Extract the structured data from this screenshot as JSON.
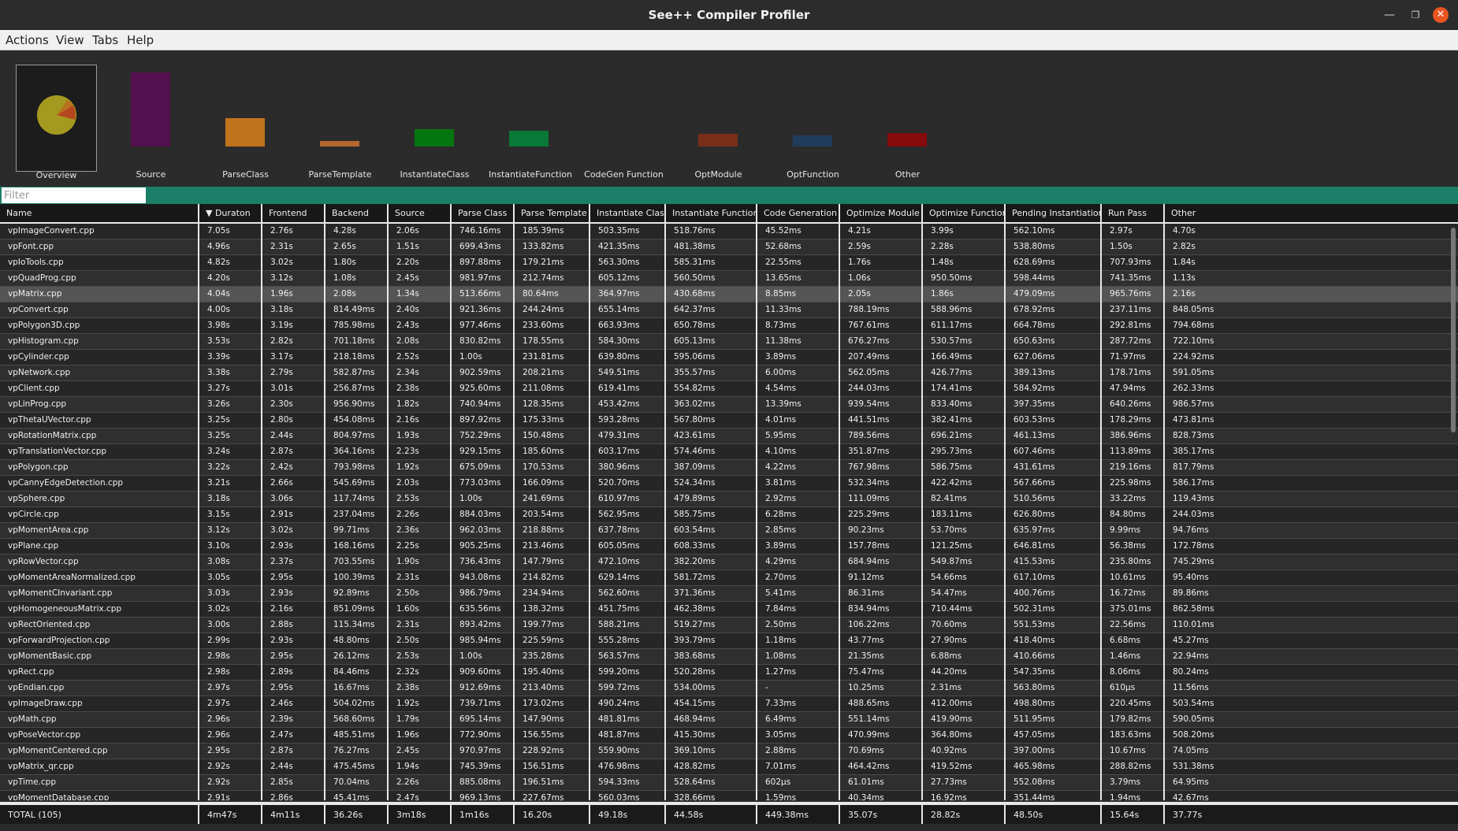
{
  "window": {
    "title": "See++ Compiler Profiler"
  },
  "menu": [
    "Actions",
    "View",
    "Tabs",
    "Help"
  ],
  "categories": [
    {
      "label": "Overview",
      "icon": "pie-chart-icon"
    },
    {
      "label": "Source",
      "icon": "bar-icon",
      "color": "#55104f"
    },
    {
      "label": "ParseClass",
      "icon": "bar-icon",
      "color": "#c0731d"
    },
    {
      "label": "ParseTemplate",
      "icon": "bar-icon",
      "color": "#b5672e"
    },
    {
      "label": "InstantiateClass",
      "icon": "bar-icon",
      "color": "#05750f"
    },
    {
      "label": "InstantiateFunction",
      "icon": "bar-icon",
      "color": "#087936"
    },
    {
      "label": "CodeGen Function",
      "icon": "bar-icon",
      "color": "#2b2b2b"
    },
    {
      "label": "OptModule",
      "icon": "bar-icon",
      "color": "#7a2e17"
    },
    {
      "label": "OptFunction",
      "icon": "bar-icon",
      "color": "#213c5a"
    },
    {
      "label": "Other",
      "icon": "bar-icon",
      "color": "#860b0b"
    }
  ],
  "filter": {
    "placeholder": "Filter"
  },
  "table": {
    "columns": [
      "Name",
      "▼ Duraton",
      "Frontend",
      "Backend",
      "Source",
      "Parse Class",
      "Parse Template",
      "Instantiate Class",
      "Instantiate Function",
      "Code Generation",
      "Optimize Module",
      "Optimize Function",
      "Pending Instantiations",
      "Run Pass",
      "Other"
    ],
    "highlight_row": 4,
    "rows": [
      [
        "vpImageConvert.cpp",
        "7.05s",
        "2.76s",
        "4.28s",
        "2.06s",
        "746.16ms",
        "185.39ms",
        "503.35ms",
        "518.76ms",
        "45.52ms",
        "4.21s",
        "3.99s",
        "562.10ms",
        "2.97s",
        "4.70s"
      ],
      [
        "vpFont.cpp",
        "4.96s",
        "2.31s",
        "2.65s",
        "1.51s",
        "699.43ms",
        "133.82ms",
        "421.35ms",
        "481.38ms",
        "52.68ms",
        "2.59s",
        "2.28s",
        "538.80ms",
        "1.50s",
        "2.82s"
      ],
      [
        "vpIoTools.cpp",
        "4.82s",
        "3.02s",
        "1.80s",
        "2.20s",
        "897.88ms",
        "179.21ms",
        "563.30ms",
        "585.31ms",
        "22.55ms",
        "1.76s",
        "1.48s",
        "628.69ms",
        "707.93ms",
        "1.84s"
      ],
      [
        "vpQuadProg.cpp",
        "4.20s",
        "3.12s",
        "1.08s",
        "2.45s",
        "981.97ms",
        "212.74ms",
        "605.12ms",
        "560.50ms",
        "13.65ms",
        "1.06s",
        "950.50ms",
        "598.44ms",
        "741.35ms",
        "1.13s"
      ],
      [
        "vpMatrix.cpp",
        "4.04s",
        "1.96s",
        "2.08s",
        "1.34s",
        "513.66ms",
        "80.64ms",
        "364.97ms",
        "430.68ms",
        "8.85ms",
        "2.05s",
        "1.86s",
        "479.09ms",
        "965.76ms",
        "2.16s"
      ],
      [
        "vpConvert.cpp",
        "4.00s",
        "3.18s",
        "814.49ms",
        "2.40s",
        "921.36ms",
        "244.24ms",
        "655.14ms",
        "642.37ms",
        "11.33ms",
        "788.19ms",
        "588.96ms",
        "678.92ms",
        "237.11ms",
        "848.05ms"
      ],
      [
        "vpPolygon3D.cpp",
        "3.98s",
        "3.19s",
        "785.98ms",
        "2.43s",
        "977.46ms",
        "233.60ms",
        "663.93ms",
        "650.78ms",
        "8.73ms",
        "767.61ms",
        "611.17ms",
        "664.78ms",
        "292.81ms",
        "794.68ms"
      ],
      [
        "vpHistogram.cpp",
        "3.53s",
        "2.82s",
        "701.18ms",
        "2.08s",
        "830.82ms",
        "178.55ms",
        "584.30ms",
        "605.13ms",
        "11.38ms",
        "676.27ms",
        "530.57ms",
        "650.63ms",
        "287.72ms",
        "722.10ms"
      ],
      [
        "vpCylinder.cpp",
        "3.39s",
        "3.17s",
        "218.18ms",
        "2.52s",
        "1.00s",
        "231.81ms",
        "639.80ms",
        "595.06ms",
        "3.89ms",
        "207.49ms",
        "166.49ms",
        "627.06ms",
        "71.97ms",
        "224.92ms"
      ],
      [
        "vpNetwork.cpp",
        "3.38s",
        "2.79s",
        "582.87ms",
        "2.34s",
        "902.59ms",
        "208.21ms",
        "549.51ms",
        "355.57ms",
        "6.00ms",
        "562.05ms",
        "426.77ms",
        "389.13ms",
        "178.71ms",
        "591.05ms"
      ],
      [
        "vpClient.cpp",
        "3.27s",
        "3.01s",
        "256.87ms",
        "2.38s",
        "925.60ms",
        "211.08ms",
        "619.41ms",
        "554.82ms",
        "4.54ms",
        "244.03ms",
        "174.41ms",
        "584.92ms",
        "47.94ms",
        "262.33ms"
      ],
      [
        "vpLinProg.cpp",
        "3.26s",
        "2.30s",
        "956.90ms",
        "1.82s",
        "740.94ms",
        "128.35ms",
        "453.42ms",
        "363.02ms",
        "13.39ms",
        "939.54ms",
        "833.40ms",
        "397.35ms",
        "640.26ms",
        "986.57ms"
      ],
      [
        "vpThetaUVector.cpp",
        "3.25s",
        "2.80s",
        "454.08ms",
        "2.16s",
        "897.92ms",
        "175.33ms",
        "593.28ms",
        "567.80ms",
        "4.01ms",
        "441.51ms",
        "382.41ms",
        "603.53ms",
        "178.29ms",
        "473.81ms"
      ],
      [
        "vpRotationMatrix.cpp",
        "3.25s",
        "2.44s",
        "804.97ms",
        "1.93s",
        "752.29ms",
        "150.48ms",
        "479.31ms",
        "423.61ms",
        "5.95ms",
        "789.56ms",
        "696.21ms",
        "461.13ms",
        "386.96ms",
        "828.73ms"
      ],
      [
        "vpTranslationVector.cpp",
        "3.24s",
        "2.87s",
        "364.16ms",
        "2.23s",
        "929.15ms",
        "185.60ms",
        "603.17ms",
        "574.46ms",
        "4.10ms",
        "351.87ms",
        "295.73ms",
        "607.46ms",
        "113.89ms",
        "385.17ms"
      ],
      [
        "vpPolygon.cpp",
        "3.22s",
        "2.42s",
        "793.98ms",
        "1.92s",
        "675.09ms",
        "170.53ms",
        "380.96ms",
        "387.09ms",
        "4.22ms",
        "767.98ms",
        "586.75ms",
        "431.61ms",
        "219.16ms",
        "817.79ms"
      ],
      [
        "vpCannyEdgeDetection.cpp",
        "3.21s",
        "2.66s",
        "545.69ms",
        "2.03s",
        "773.03ms",
        "166.09ms",
        "520.70ms",
        "524.34ms",
        "3.81ms",
        "532.34ms",
        "422.42ms",
        "567.66ms",
        "225.98ms",
        "586.17ms"
      ],
      [
        "vpSphere.cpp",
        "3.18s",
        "3.06s",
        "117.74ms",
        "2.53s",
        "1.00s",
        "241.69ms",
        "610.97ms",
        "479.89ms",
        "2.92ms",
        "111.09ms",
        "82.41ms",
        "510.56ms",
        "33.22ms",
        "119.43ms"
      ],
      [
        "vpCircle.cpp",
        "3.15s",
        "2.91s",
        "237.04ms",
        "2.26s",
        "884.03ms",
        "203.54ms",
        "562.95ms",
        "585.75ms",
        "6.28ms",
        "225.29ms",
        "183.11ms",
        "626.80ms",
        "84.80ms",
        "244.03ms"
      ],
      [
        "vpMomentArea.cpp",
        "3.12s",
        "3.02s",
        "99.71ms",
        "2.36s",
        "962.03ms",
        "218.88ms",
        "637.78ms",
        "603.54ms",
        "2.85ms",
        "90.23ms",
        "53.70ms",
        "635.97ms",
        "9.99ms",
        "94.76ms"
      ],
      [
        "vpPlane.cpp",
        "3.10s",
        "2.93s",
        "168.16ms",
        "2.25s",
        "905.25ms",
        "213.46ms",
        "605.05ms",
        "608.33ms",
        "3.89ms",
        "157.78ms",
        "121.25ms",
        "646.81ms",
        "56.38ms",
        "172.78ms"
      ],
      [
        "vpRowVector.cpp",
        "3.08s",
        "2.37s",
        "703.55ms",
        "1.90s",
        "736.43ms",
        "147.79ms",
        "472.10ms",
        "382.20ms",
        "4.29ms",
        "684.94ms",
        "549.87ms",
        "415.53ms",
        "235.80ms",
        "745.29ms"
      ],
      [
        "vpMomentAreaNormalized.cpp",
        "3.05s",
        "2.95s",
        "100.39ms",
        "2.31s",
        "943.08ms",
        "214.82ms",
        "629.14ms",
        "581.72ms",
        "2.70ms",
        "91.12ms",
        "54.66ms",
        "617.10ms",
        "10.61ms",
        "95.40ms"
      ],
      [
        "vpMomentCInvariant.cpp",
        "3.03s",
        "2.93s",
        "92.89ms",
        "2.50s",
        "986.79ms",
        "234.94ms",
        "562.60ms",
        "371.36ms",
        "5.41ms",
        "86.31ms",
        "54.47ms",
        "400.76ms",
        "16.72ms",
        "89.86ms"
      ],
      [
        "vpHomogeneousMatrix.cpp",
        "3.02s",
        "2.16s",
        "851.09ms",
        "1.60s",
        "635.56ms",
        "138.32ms",
        "451.75ms",
        "462.38ms",
        "7.84ms",
        "834.94ms",
        "710.44ms",
        "502.31ms",
        "375.01ms",
        "862.58ms"
      ],
      [
        "vpRectOriented.cpp",
        "3.00s",
        "2.88s",
        "115.34ms",
        "2.31s",
        "893.42ms",
        "199.77ms",
        "588.21ms",
        "519.27ms",
        "2.50ms",
        "106.22ms",
        "70.60ms",
        "551.53ms",
        "22.56ms",
        "110.01ms"
      ],
      [
        "vpForwardProjection.cpp",
        "2.99s",
        "2.93s",
        "48.80ms",
        "2.50s",
        "985.94ms",
        "225.59ms",
        "555.28ms",
        "393.79ms",
        "1.18ms",
        "43.77ms",
        "27.90ms",
        "418.40ms",
        "6.68ms",
        "45.27ms"
      ],
      [
        "vpMomentBasic.cpp",
        "2.98s",
        "2.95s",
        "26.12ms",
        "2.53s",
        "1.00s",
        "235.28ms",
        "563.57ms",
        "383.68ms",
        "1.08ms",
        "21.35ms",
        "6.88ms",
        "410.66ms",
        "1.46ms",
        "22.94ms"
      ],
      [
        "vpRect.cpp",
        "2.98s",
        "2.89s",
        "84.46ms",
        "2.32s",
        "909.60ms",
        "195.40ms",
        "599.20ms",
        "520.28ms",
        "1.27ms",
        "75.47ms",
        "44.20ms",
        "547.35ms",
        "8.06ms",
        "80.24ms"
      ],
      [
        "vpEndian.cpp",
        "2.97s",
        "2.95s",
        "16.67ms",
        "2.38s",
        "912.69ms",
        "213.40ms",
        "599.72ms",
        "534.00ms",
        "-",
        "10.25ms",
        "2.31ms",
        "563.80ms",
        "610µs",
        "11.56ms"
      ],
      [
        "vpImageDraw.cpp",
        "2.97s",
        "2.46s",
        "504.02ms",
        "1.92s",
        "739.71ms",
        "173.02ms",
        "490.24ms",
        "454.15ms",
        "7.33ms",
        "488.65ms",
        "412.00ms",
        "498.80ms",
        "220.45ms",
        "503.54ms"
      ],
      [
        "vpMath.cpp",
        "2.96s",
        "2.39s",
        "568.60ms",
        "1.79s",
        "695.14ms",
        "147.90ms",
        "481.81ms",
        "468.94ms",
        "6.49ms",
        "551.14ms",
        "419.90ms",
        "511.95ms",
        "179.82ms",
        "590.05ms"
      ],
      [
        "vpPoseVector.cpp",
        "2.96s",
        "2.47s",
        "485.51ms",
        "1.96s",
        "772.90ms",
        "156.55ms",
        "481.87ms",
        "415.30ms",
        "3.05ms",
        "470.99ms",
        "364.80ms",
        "457.05ms",
        "183.63ms",
        "508.20ms"
      ],
      [
        "vpMomentCentered.cpp",
        "2.95s",
        "2.87s",
        "76.27ms",
        "2.45s",
        "970.97ms",
        "228.92ms",
        "559.90ms",
        "369.10ms",
        "2.88ms",
        "70.69ms",
        "40.92ms",
        "397.00ms",
        "10.67ms",
        "74.05ms"
      ],
      [
        "vpMatrix_qr.cpp",
        "2.92s",
        "2.44s",
        "475.45ms",
        "1.94s",
        "745.39ms",
        "156.51ms",
        "476.98ms",
        "428.82ms",
        "7.01ms",
        "464.42ms",
        "419.52ms",
        "465.98ms",
        "288.82ms",
        "531.38ms"
      ],
      [
        "vpTime.cpp",
        "2.92s",
        "2.85s",
        "70.04ms",
        "2.26s",
        "885.08ms",
        "196.51ms",
        "594.33ms",
        "528.64ms",
        "602µs",
        "61.01ms",
        "27.73ms",
        "552.08ms",
        "3.79ms",
        "64.95ms"
      ],
      [
        "vpMomentDatabase.cpp",
        "2.91s",
        "2.86s",
        "45.41ms",
        "2.47s",
        "969.13ms",
        "227.67ms",
        "560.03ms",
        "328.66ms",
        "1.59ms",
        "40.34ms",
        "16.92ms",
        "351.44ms",
        "1.94ms",
        "42.67ms"
      ]
    ],
    "total": [
      "TOTAL (105)",
      "4m47s",
      "4m11s",
      "36.26s",
      "3m18s",
      "1m16s",
      "16.20s",
      "49.18s",
      "44.58s",
      "449.38ms",
      "35.07s",
      "28.82s",
      "48.50s",
      "15.64s",
      "37.77s"
    ]
  }
}
